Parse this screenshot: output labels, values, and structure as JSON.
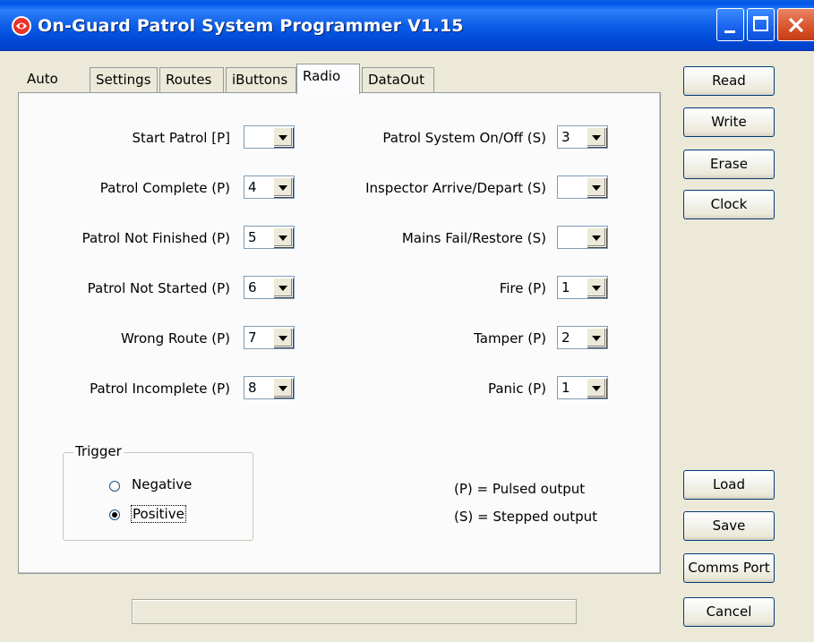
{
  "window": {
    "title": "On-Guard Patrol System Programmer V1.15",
    "icon": "app-logo-icon",
    "controls": [
      "minimize-icon",
      "maximize-icon",
      "close-icon"
    ]
  },
  "tabs": [
    {
      "label": "Auto",
      "active": false
    },
    {
      "label": "Settings",
      "active": false
    },
    {
      "label": "Routes",
      "active": false
    },
    {
      "label": "iButtons",
      "active": false
    },
    {
      "label": "Radio",
      "active": true
    },
    {
      "label": "DataOut",
      "active": false
    }
  ],
  "left_fields": [
    {
      "label": "Start Patrol [P]",
      "value": ""
    },
    {
      "label": "Patrol Complete (P)",
      "value": "4"
    },
    {
      "label": "Patrol Not Finished (P)",
      "value": "5"
    },
    {
      "label": "Patrol Not Started (P)",
      "value": "6"
    },
    {
      "label": "Wrong Route (P)",
      "value": "7"
    },
    {
      "label": "Patrol Incomplete (P)",
      "value": "8"
    }
  ],
  "right_fields": [
    {
      "label": "Patrol System On/Off (S)",
      "value": "3"
    },
    {
      "label": "Inspector Arrive/Depart (S)",
      "value": ""
    },
    {
      "label": "Mains Fail/Restore (S)",
      "value": ""
    },
    {
      "label": "Fire (P)",
      "value": "1"
    },
    {
      "label": "Tamper (P)",
      "value": "2"
    },
    {
      "label": "Panic (P)",
      "value": "1"
    }
  ],
  "trigger": {
    "title": "Trigger",
    "options": [
      {
        "label": "Negative",
        "checked": false
      },
      {
        "label": "Positive",
        "checked": true
      }
    ]
  },
  "legend": {
    "pulsed": "(P) = Pulsed output",
    "stepped": "(S) = Stepped output"
  },
  "buttons": {
    "read": "Read",
    "write": "Write",
    "erase": "Erase",
    "clock": "Clock",
    "load": "Load",
    "save": "Save",
    "comms_port": "Comms Port",
    "cancel": "Cancel"
  },
  "status": ""
}
